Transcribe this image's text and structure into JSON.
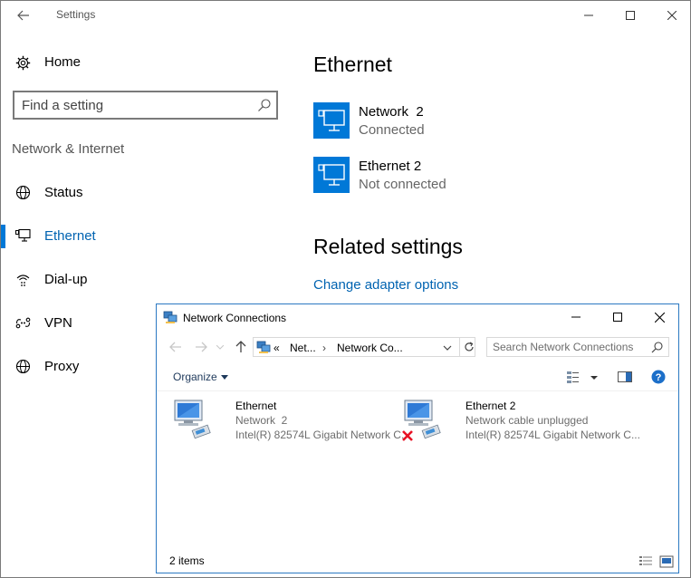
{
  "settings": {
    "title": "Settings",
    "home_label": "Home",
    "search_placeholder": "Find a setting",
    "section_title": "Network & Internet",
    "nav": [
      {
        "label": "Status",
        "icon": "globe-icon"
      },
      {
        "label": "Ethernet",
        "icon": "ethernet-icon",
        "active": true
      },
      {
        "label": "Dial-up",
        "icon": "dialup-icon"
      },
      {
        "label": "VPN",
        "icon": "vpn-icon"
      },
      {
        "label": "Proxy",
        "icon": "globe-icon"
      }
    ],
    "page_title": "Ethernet",
    "networks": [
      {
        "name": "Network  2",
        "status": "Connected"
      },
      {
        "name": "Ethernet 2",
        "status": "Not connected"
      }
    ],
    "related_title": "Related settings",
    "related_link": "Change adapter options"
  },
  "network_connections": {
    "title": "Network Connections",
    "breadcrumb_prefix": "«",
    "breadcrumbs": [
      "Net...",
      "Network Co..."
    ],
    "search_placeholder": "Search Network Connections",
    "organize_label": "Organize",
    "connections": [
      {
        "name": "Ethernet",
        "network": "Network  2",
        "device": "Intel(R) 82574L Gigabit Network C...",
        "disconnected": false
      },
      {
        "name": "Ethernet 2",
        "network": "Network cable unplugged",
        "device": "Intel(R) 82574L Gigabit Network C...",
        "disconnected": true
      }
    ],
    "item_count": "2 items"
  },
  "colors": {
    "accent": "#0078d7",
    "link": "#0063b1",
    "error": "#e81123"
  }
}
